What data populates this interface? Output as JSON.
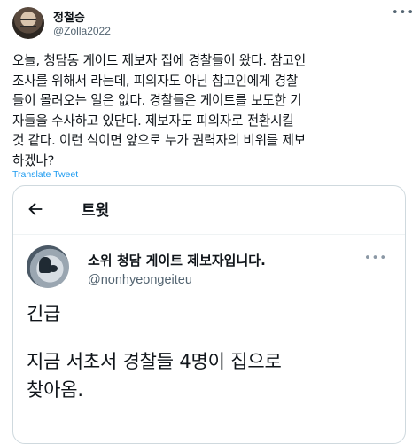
{
  "author": {
    "display_name": "정철승",
    "handle": "@Zolla2022",
    "avatar_icon": "profile-photo"
  },
  "tweet": {
    "text_lines": [
      "오늘, 청담동 게이트 제보자 집에 경찰들이 왔다. 참고인",
      "조사를 위해서 라는데, 피의자도 아닌 참고인에게 경찰",
      "들이 몰려오는 일은 없다. 경찰들은 게이트를 보도한 기",
      "자들을 수사하고 있단다. 제보자도 피의자로 전환시킬",
      "것 같다. 이런 식이면 앞으로 누가 권력자의 비위를 제보",
      "하겠나?"
    ],
    "translate_label": "Translate Tweet"
  },
  "quoted": {
    "header_title": "트윗",
    "author_name": "소위 청담 게이트 제보자입니다.",
    "author_handle": "@nonhyeongeiteu",
    "lines": [
      "긴급",
      "",
      "지금 서초서 경찰들 4명이 집으로",
      "찾아옴."
    ]
  },
  "colors": {
    "link": "#1d9bf0",
    "secondary_text": "#536471",
    "border": "#cfd9de"
  }
}
